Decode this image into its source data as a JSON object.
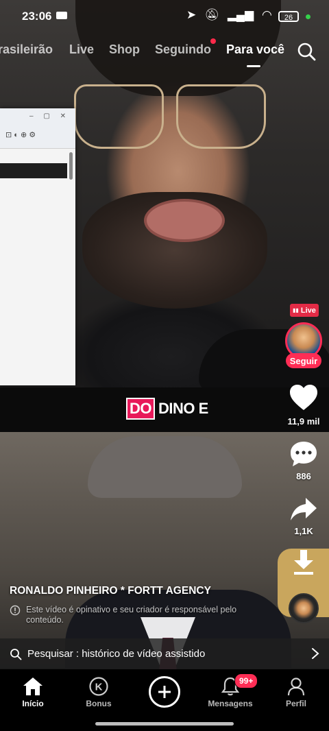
{
  "status_bar": {
    "time": "23:06",
    "battery": "26"
  },
  "top_tabs": [
    {
      "label": "rasileirão"
    },
    {
      "label": "Live"
    },
    {
      "label": "Shop"
    },
    {
      "label": "Seguindo"
    },
    {
      "label": "Para você"
    }
  ],
  "active_tab": "Para você",
  "right_rail": {
    "live_label": "Live",
    "follow_label": "Seguir",
    "likes": "11,9 mil",
    "comments": "886",
    "shares": "1,1K"
  },
  "overlay_logo": {
    "part1": "DO",
    "part2": "DINO E"
  },
  "video": {
    "author": "RONALDO PINHEIRO * FORTT AGENCY",
    "disclaimer": "Este vídeo é opinativo e seu criador é responsável pelo conteúdo."
  },
  "search_suggestion": "Pesquisar : histórico de vídeo assistido",
  "bottom_nav": {
    "home": "Início",
    "bonus": "Bonus",
    "messages": "Mensagens",
    "messages_badge": "99+",
    "profile": "Perfil"
  },
  "colors": {
    "accent": "#ff2d55",
    "live": "#e32b46",
    "logo_pink": "#e8195a"
  }
}
